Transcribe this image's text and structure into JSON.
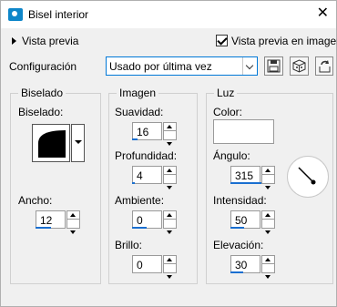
{
  "window": {
    "title": "Bisel interior",
    "close_glyph": "✕"
  },
  "top": {
    "preview_toggle_label": "Vista previa",
    "preview_checkbox_label": "Vista previa en imagen",
    "preview_checkbox_checked": true,
    "config_label": "Configuración",
    "config_value": "Usado por última vez",
    "buttons": [
      "save-icon",
      "random-icon",
      "reset-icon"
    ]
  },
  "groups": {
    "biselado": {
      "title": "Biselado",
      "bevel_label": "Biselado:",
      "width_label": "Ancho:",
      "width_value": "12"
    },
    "imagen": {
      "title": "Imagen",
      "suavidad_label": "Suavidad:",
      "suavidad_value": "16",
      "profundidad_label": "Profundidad:",
      "profundidad_value": "4",
      "ambiente_label": "Ambiente:",
      "ambiente_value": "0",
      "brillo_label": "Brillo:",
      "brillo_value": "0"
    },
    "luz": {
      "title": "Luz",
      "color_label": "Color:",
      "color_value": "#ffffff",
      "angulo_label": "Ángulo:",
      "angulo_value": "315",
      "intensidad_label": "Intensidad:",
      "intensidad_value": "50",
      "elevacion_label": "Elevación:",
      "elevacion_value": "30"
    }
  },
  "colors": {
    "accent": "#1a6fd0",
    "title_icon": "#0e86c9",
    "window_bg": "#f0f0f0"
  }
}
